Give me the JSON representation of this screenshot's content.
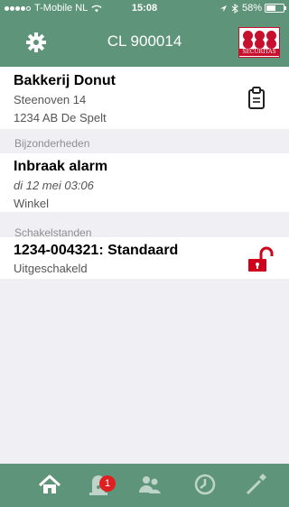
{
  "status_bar": {
    "carrier": "T-Mobile NL",
    "time": "15:08",
    "battery_text": "58%",
    "battery_level": 0.58
  },
  "nav": {
    "title": "CL 900014",
    "logo_text": "SECURITAS"
  },
  "address": {
    "name": "Bakkerij Donut",
    "street": "Steenoven 14",
    "city": "1234 AB  De Spelt"
  },
  "details": {
    "header": "Bijzonderheden",
    "event_title": "Inbraak alarm",
    "event_time": "di 12 mei 03:06",
    "event_location": "Winkel"
  },
  "switch_states": {
    "header": "Schakelstanden",
    "item_title": "1234-004321: Standaard",
    "item_status": "Uitgeschakeld"
  },
  "tabbar": {
    "alarm_badge": "1"
  },
  "colors": {
    "brand_green": "#5e9479",
    "alert_red": "#e02020",
    "lock_red": "#d0021b"
  }
}
